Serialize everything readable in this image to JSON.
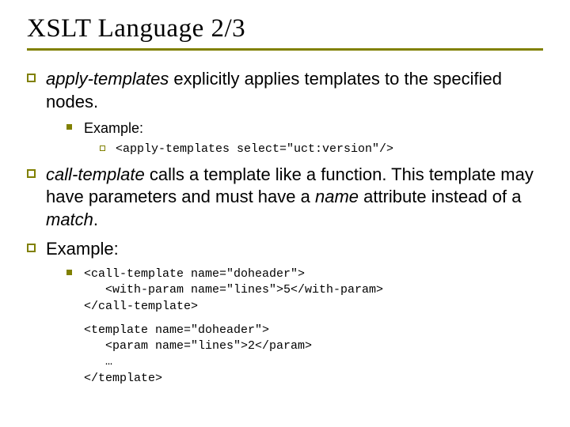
{
  "title": "XSLT Language 2/3",
  "p1": {
    "term": "apply-templates",
    "rest": " explicitly applies templates to the specified nodes."
  },
  "p1_example_label": "Example:",
  "p1_example_code": "<apply-templates select=\"uct:version\"/>",
  "p2": {
    "term": "call-template",
    "part1": " calls a template like a function. This template may have parameters and must have a ",
    "name_word": "name",
    "part2": " attribute instead of a ",
    "match_word": "match",
    "part3": "."
  },
  "p3": "Example:",
  "code1": "<call-template name=\"doheader\">\n   <with-param name=\"lines\">5</with-param>\n</call-template>",
  "code2": "<template name=\"doheader\">\n   <param name=\"lines\">2</param>\n   …\n</template>"
}
